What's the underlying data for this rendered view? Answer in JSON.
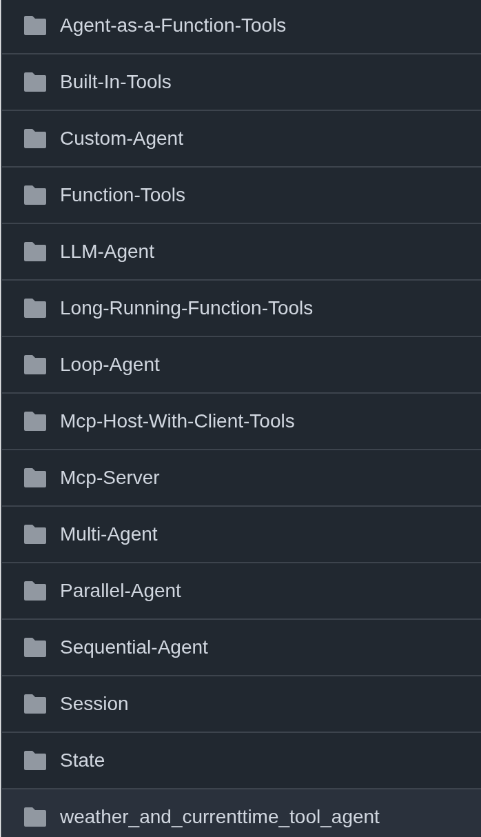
{
  "rows": [
    {
      "name": "Agent-as-a-Function-Tools",
      "highlighted": false
    },
    {
      "name": "Built-In-Tools",
      "highlighted": false
    },
    {
      "name": "Custom-Agent",
      "highlighted": false
    },
    {
      "name": "Function-Tools",
      "highlighted": false
    },
    {
      "name": "LLM-Agent",
      "highlighted": false
    },
    {
      "name": "Long-Running-Function-Tools",
      "highlighted": false
    },
    {
      "name": "Loop-Agent",
      "highlighted": false
    },
    {
      "name": "Mcp-Host-With-Client-Tools",
      "highlighted": false
    },
    {
      "name": "Mcp-Server",
      "highlighted": false
    },
    {
      "name": "Multi-Agent",
      "highlighted": false
    },
    {
      "name": "Parallel-Agent",
      "highlighted": false
    },
    {
      "name": "Sequential-Agent",
      "highlighted": false
    },
    {
      "name": "Session",
      "highlighted": false
    },
    {
      "name": "State",
      "highlighted": false
    },
    {
      "name": "weather_and_currenttime_tool_agent",
      "highlighted": true
    }
  ]
}
